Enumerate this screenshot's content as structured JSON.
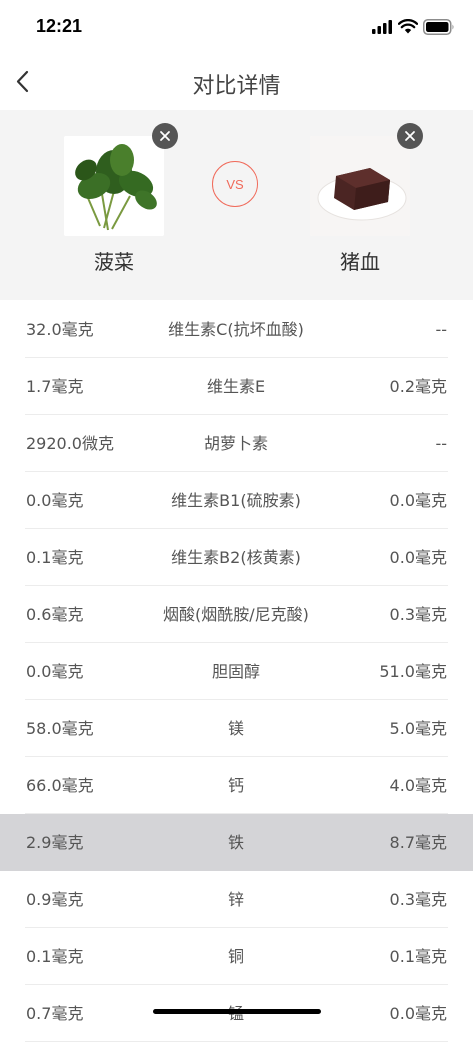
{
  "status_bar": {
    "time": "12:21"
  },
  "nav": {
    "title": "对比详情"
  },
  "compare": {
    "left_food": "菠菜",
    "right_food": "猪血",
    "vs_label": "VS"
  },
  "rows": [
    {
      "left": "32.0毫克",
      "nutrient": "维生素C(抗坏血酸)",
      "right": "--"
    },
    {
      "left": "1.7毫克",
      "nutrient": "维生素E",
      "right": "0.2毫克"
    },
    {
      "left": "2920.0微克",
      "nutrient": "胡萝卜素",
      "right": "--"
    },
    {
      "left": "0.0毫克",
      "nutrient": "维生素B1(硫胺素)",
      "right": "0.0毫克"
    },
    {
      "left": "0.1毫克",
      "nutrient": "维生素B2(核黄素)",
      "right": "0.0毫克"
    },
    {
      "left": "0.6毫克",
      "nutrient": "烟酸(烟酰胺/尼克酸)",
      "right": "0.3毫克"
    },
    {
      "left": "0.0毫克",
      "nutrient": "胆固醇",
      "right": "51.0毫克"
    },
    {
      "left": "58.0毫克",
      "nutrient": "镁",
      "right": "5.0毫克"
    },
    {
      "left": "66.0毫克",
      "nutrient": "钙",
      "right": "4.0毫克"
    },
    {
      "left": "2.9毫克",
      "nutrient": "铁",
      "right": "8.7毫克",
      "highlight": true
    },
    {
      "left": "0.9毫克",
      "nutrient": "锌",
      "right": "0.3毫克"
    },
    {
      "left": "0.1毫克",
      "nutrient": "铜",
      "right": "0.1毫克"
    },
    {
      "left": "0.7毫克",
      "nutrient": "锰",
      "right": "0.0毫克"
    }
  ],
  "colors": {
    "accent": "#f06a5a",
    "highlight_row": "#d4d4d7",
    "panel_bg": "#f4f4f4"
  }
}
